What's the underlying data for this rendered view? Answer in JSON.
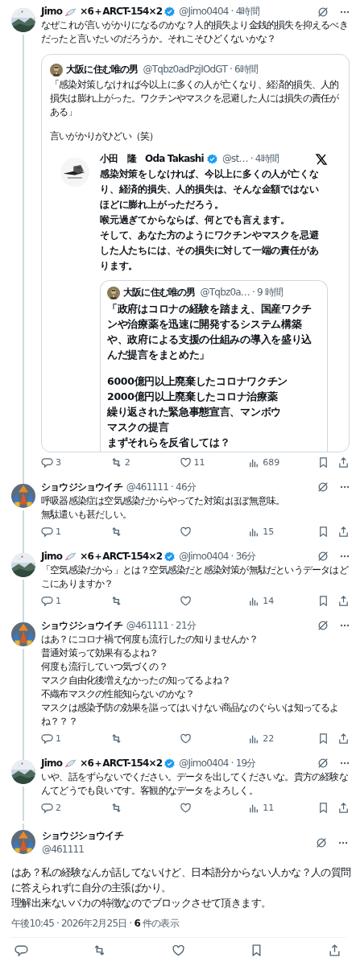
{
  "thread": [
    {
      "name": "Jimo",
      "name_suffix": "×6＋ARCT-154×2",
      "verified": true,
      "meta": "@Jimo0404 · 4時間",
      "body": [
        "なぜこれが言いがかりになるのかな？人的損失より金銭的損失を抑えるべきだったと言いたいのだろうか。それこそひどくないかな？"
      ],
      "quote": {
        "name": "大阪に住む唯の男",
        "meta": "@Tqbz0adPzjIOdGT · 6時間",
        "paragraphs": [
          [
            "「感染対策しなければ今以上に多くの人が亡くなり、経済的損失、人的損失は膨れ上がった。ワクチンやマスクを忌避した人には損失の責任がある」"
          ],
          [
            "言いがかりがひどい（笑）"
          ]
        ],
        "embed": {
          "name": "小田　隆　Oda Takashi",
          "verified": true,
          "meta": "@st… · 4時間",
          "body": [
            "感染対策をしなければ、今以上に多くの人が亡くなり、経済的損失、人的損失は、そんな金額ではないほどに膨れ上がっただろう。",
            "喉元過ぎてからならば、何とでも言えます。",
            "そして、あなた方のようにワクチンやマスクを忌避した人たちには、その損失に対して一端の責任があります。"
          ],
          "quote": {
            "name": "大阪に住む唯の男",
            "meta": "@Tqbz0a… · 9 時間",
            "paragraphs": [
              [
                "「政府はコロナの経験を踏まえ、国産ワクチンや治療薬を迅速に開発するシステム構築や、政府による支援の仕組みの導入を盛り込んだ提言をまとめた」"
              ],
              [
                "6000億円以上廃棄したコロナワクチン",
                "2000億円以上廃棄したコロナ治療薬",
                "繰り返された緊急事態宣言、マンボウ",
                "マスクの提言",
                "まずそれらを反省しては？"
              ]
            ]
          }
        }
      },
      "actions": {
        "replies": "3",
        "reposts": "2",
        "likes": "11",
        "views": "689"
      }
    },
    {
      "name": "ショウジショウイチ",
      "verified": false,
      "meta": "@461111 · 46分",
      "body": [
        "呼吸器感染症は空気感染だからやってた対策はほぼ無意味。",
        "無駄遣いも甚だしい。"
      ],
      "actions": {
        "replies": "1",
        "views": "15"
      }
    },
    {
      "name": "Jimo",
      "name_suffix": "×6＋ARCT-154×2",
      "verified": true,
      "meta": "@Jimo0404 · 36分",
      "body": [
        "「空気感染だから」とは？空気感染だと感染対策が無駄だというデータはどこにありますか？"
      ],
      "actions": {
        "replies": "1",
        "views": "14"
      }
    },
    {
      "name": "ショウジショウイチ",
      "verified": false,
      "meta": "@461111 · 21分",
      "body": [
        "はあ？にコロナ禍で何度も流行したの知りませんか？",
        "普通対策って効果有るよね？",
        "何度も流行していつ気づくの？",
        "マスク自由化後増えなかったの知ってるよね？",
        "不織布マスクの性能知らないのかな？",
        "マスクは感染予防の効果を謳ってはいけない商品なのぐらいは知ってるよね？？？"
      ],
      "actions": {
        "replies": "1",
        "views": "22"
      }
    },
    {
      "name": "Jimo",
      "name_suffix": "×6＋ARCT-154×2",
      "verified": true,
      "meta": "@Jimo0404 · 19分",
      "body": [
        "いや、話をずらないでください。データを出してくださいな。貴方の経験なんてどうでも良いです。客観的なデータをよろしく。"
      ],
      "actions": {
        "replies": "2",
        "views": "11"
      }
    }
  ],
  "focused": {
    "name": "ショウジショウイチ",
    "verified": false,
    "handle": "@461111",
    "body": [
      "はあ？私の経験なんか話してないけど、日本語分からない人かな？人の質問に答えられずに自分の主張ばかり。",
      "理解出来ないバカの特徴なのでブロックさせて頂きます。"
    ],
    "footer": "午後10:45 · 2026年2月25日 · **6** 件の表示"
  }
}
